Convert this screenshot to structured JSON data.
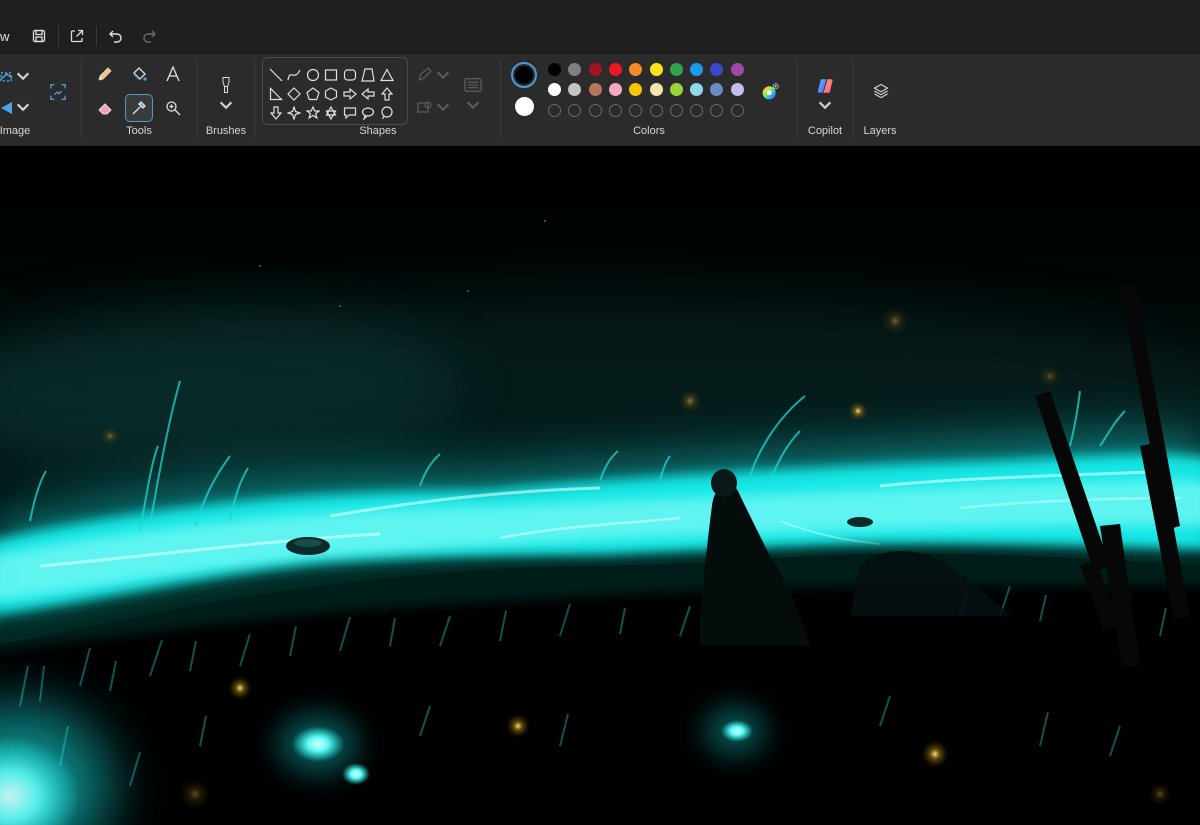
{
  "titlebar": {
    "menu_fragment": "w",
    "buttons": [
      "save-icon",
      "share-icon",
      "undo-icon",
      "redo-icon"
    ]
  },
  "ribbon": {
    "groups": {
      "image": "Image",
      "tools": "Tools",
      "brushes": "Brushes",
      "shapes": "Shapes",
      "colors": "Colors",
      "copilot": "Copilot",
      "layers": "Layers"
    },
    "tools": [
      "pencil-icon",
      "fill-icon",
      "text-icon",
      "eraser-icon",
      "color-picker-icon",
      "magnifier-icon"
    ],
    "active_tool": "color-picker-icon"
  },
  "colors": {
    "primary": "#000000",
    "secondary": "#ffffff",
    "row1": [
      "#000000",
      "#7f7f7f",
      "#a11422",
      "#e81b23",
      "#f58a29",
      "#fee31a",
      "#2ea44f",
      "#1e9be8",
      "#3e48cc",
      "#9c4aa6"
    ],
    "row2": [
      "#ffffff",
      "#c3c3c3",
      "#b5765a",
      "#f7a7bf",
      "#fbc400",
      "#f1e6a9",
      "#9bd33b",
      "#8fd9ea",
      "#6c8ac4",
      "#c5bfe7"
    ]
  },
  "canvas": {
    "accent": "#19f2f0",
    "background": "#000000"
  }
}
